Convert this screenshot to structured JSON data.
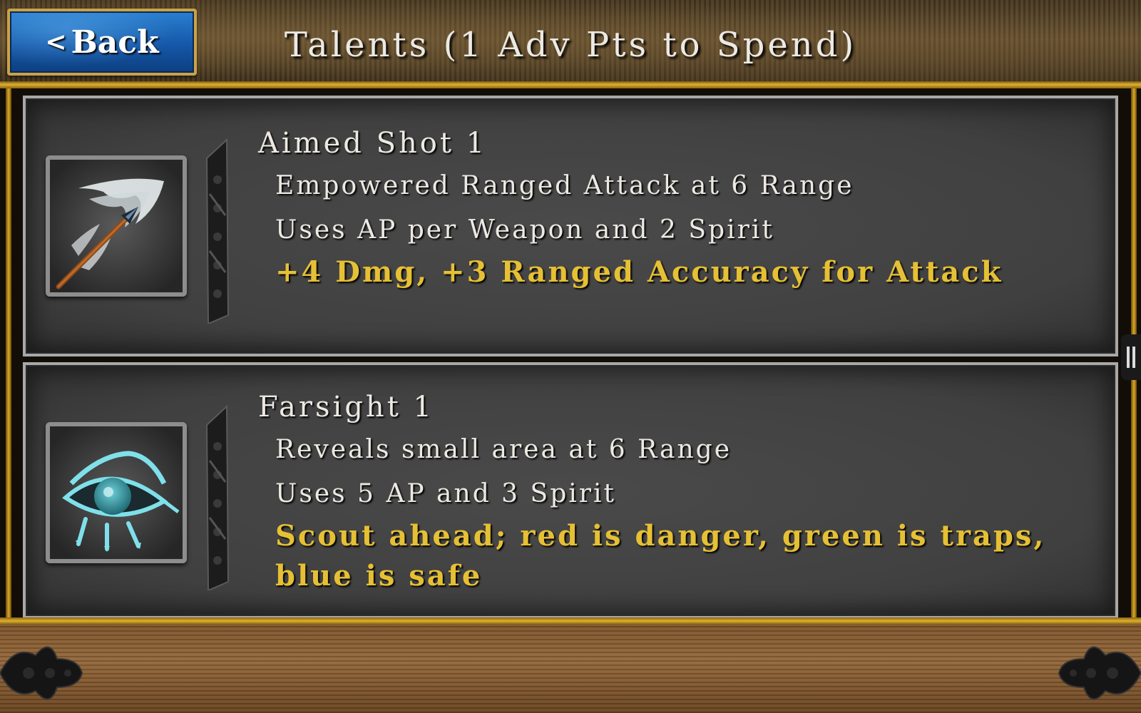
{
  "header": {
    "back_label": "Back",
    "back_chevron": "<",
    "title": "Talents (1 Adv Pts to Spend)"
  },
  "talents": [
    {
      "name": "Aimed Shot 1",
      "line1": "Empowered Ranged Attack at 6 Range",
      "line2": "Uses AP per Weapon and 2 Spirit",
      "bonus": "+4 Dmg, +3 Ranged Accuracy for Attack",
      "icon": "arrow-icon"
    },
    {
      "name": "Farsight 1",
      "line1": "Reveals small area at 6 Range",
      "line2": "Uses 5 AP and 3 Spirit",
      "bonus": "Scout ahead; red is danger, green is traps, blue is safe",
      "icon": "eye-icon"
    }
  ],
  "colors": {
    "bonus_text": "#e6c034",
    "back_button": "#1557a8",
    "gold_trim": "#e0b030"
  }
}
